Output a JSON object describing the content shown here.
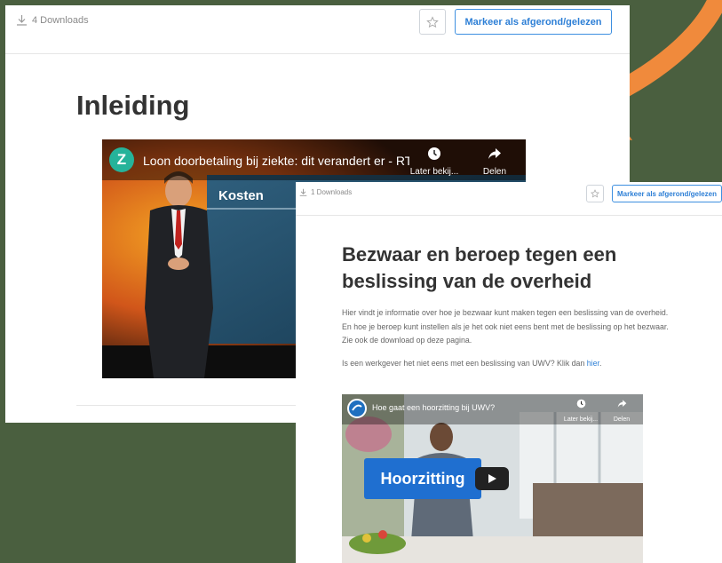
{
  "colors": {
    "background": "#4a5f3f",
    "accent_blue": "#2d7fd6",
    "arrow_orange": "#f08a3c"
  },
  "arrow": {
    "icon": "arrow-icon"
  },
  "page_a": {
    "downloads": "4 Downloads",
    "mark_button": "Markeer als afgerond/gelezen",
    "heading": "Inleiding",
    "video": {
      "channel_letter": "Z",
      "title": "Loon doorbetaling bij ziekte: dit verandert er - RT...",
      "watch_later": "Later bekij...",
      "share": "Delen",
      "screen_text": "Kosten"
    }
  },
  "page_b": {
    "downloads": "1 Downloads",
    "mark_button": "Markeer als afgerond/gelezen",
    "heading": "Bezwaar en beroep tegen een beslissing van de overheid",
    "paragraph1": "Hier vindt je informatie over hoe je bezwaar kunt maken tegen een beslissing van de overheid. En hoe je beroep kunt instellen als je het ook niet eens bent met de beslissing op het bezwaar. Zie ook de download op deze pagina.",
    "paragraph2_prefix": "Is een werkgever het niet eens met een beslissing van UWV? Klik dan ",
    "paragraph2_link": "hier",
    "paragraph2_suffix": ".",
    "video": {
      "title": "Hoe gaat een hoorzitting bij UWV?",
      "watch_later": "Later bekij...",
      "share": "Delen",
      "banner": "Hoorzitting"
    }
  }
}
